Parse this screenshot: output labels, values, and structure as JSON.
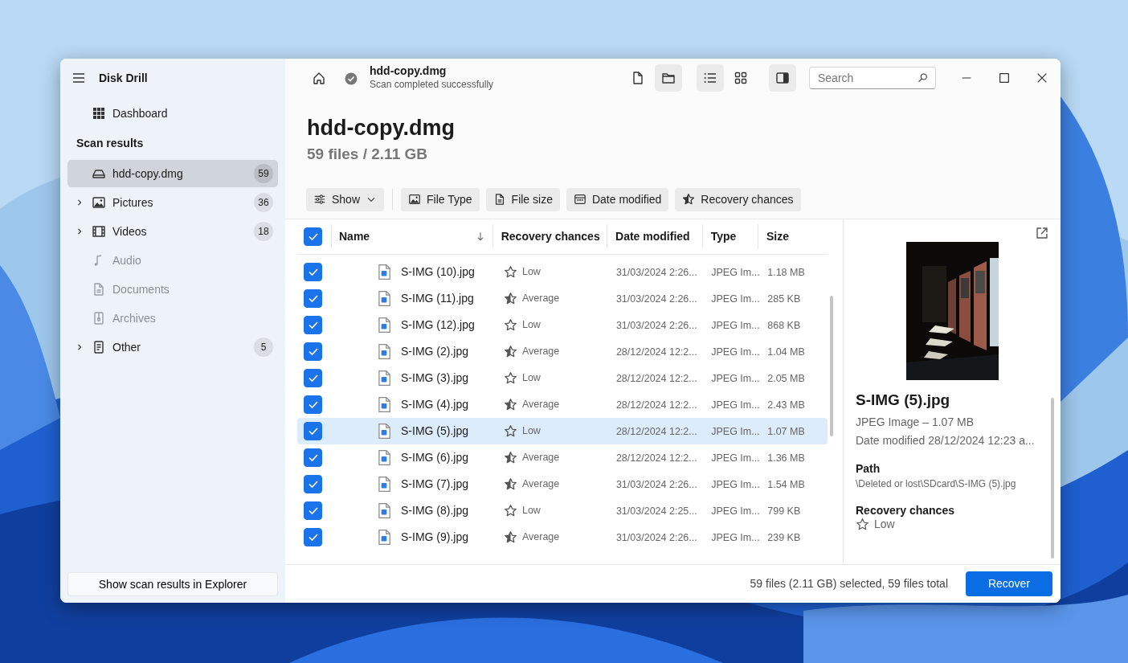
{
  "app": {
    "title": "Disk Drill"
  },
  "sidebar": {
    "dashboard": "Dashboard",
    "section": "Scan results",
    "items": [
      {
        "label": "hdd-copy.dmg",
        "count": "59",
        "expandable": false,
        "selected": true,
        "disabled": false
      },
      {
        "label": "Pictures",
        "count": "36",
        "expandable": true,
        "selected": false,
        "disabled": false
      },
      {
        "label": "Videos",
        "count": "18",
        "expandable": true,
        "selected": false,
        "disabled": false
      },
      {
        "label": "Audio",
        "expandable": false,
        "selected": false,
        "disabled": true
      },
      {
        "label": "Documents",
        "expandable": false,
        "selected": false,
        "disabled": true
      },
      {
        "label": "Archives",
        "expandable": false,
        "selected": false,
        "disabled": true
      },
      {
        "label": "Other",
        "count": "5",
        "expandable": true,
        "selected": false,
        "disabled": false
      }
    ],
    "explorer_button": "Show scan results in Explorer"
  },
  "header": {
    "source": "hdd-copy.dmg",
    "status": "Scan completed successfully",
    "toolbar": [
      {
        "kind": "file",
        "selected": false
      },
      {
        "kind": "folder",
        "selected": true
      },
      {
        "kind": "list",
        "selected": true
      },
      {
        "kind": "grid",
        "selected": false
      },
      {
        "kind": "panel",
        "selected": true
      }
    ],
    "search": {
      "placeholder": "Search"
    }
  },
  "heading": {
    "title": "hdd-copy.dmg",
    "summary": "59 files / 2.11 GB"
  },
  "filters": [
    {
      "label": "Show",
      "dropdown": true
    },
    {
      "label": "File Type",
      "dropdown": false
    },
    {
      "label": "File size",
      "dropdown": false
    },
    {
      "label": "Date modified",
      "dropdown": false
    },
    {
      "label": "Recovery chances",
      "dropdown": false
    }
  ],
  "table": {
    "all_checked": true,
    "columns": [
      {
        "label": "Name",
        "sorted": true
      },
      {
        "label": "Recovery chances",
        "sorted": false
      },
      {
        "label": "Date modified",
        "sorted": false
      },
      {
        "label": "Type",
        "sorted": false
      },
      {
        "label": "Size",
        "sorted": false
      }
    ],
    "rows": [
      {
        "name": "S-IMG (10).jpg",
        "chances": "Low",
        "kind": "low",
        "date": "31/03/2024 2:26...",
        "type": "JPEG Im...",
        "size": "1.18 MB",
        "checked": true,
        "selected": false
      },
      {
        "name": "S-IMG (11).jpg",
        "chances": "Average",
        "kind": "average",
        "date": "31/03/2024 2:26...",
        "type": "JPEG Im...",
        "size": "285 KB",
        "checked": true,
        "selected": false
      },
      {
        "name": "S-IMG (12).jpg",
        "chances": "Low",
        "kind": "low",
        "date": "31/03/2024 2:26...",
        "type": "JPEG Im...",
        "size": "868 KB",
        "checked": true,
        "selected": false
      },
      {
        "name": "S-IMG (2).jpg",
        "chances": "Average",
        "kind": "average",
        "date": "28/12/2024 12:2...",
        "type": "JPEG Im...",
        "size": "1.04 MB",
        "checked": true,
        "selected": false
      },
      {
        "name": "S-IMG (3).jpg",
        "chances": "Low",
        "kind": "low",
        "date": "28/12/2024 12:2...",
        "type": "JPEG Im...",
        "size": "2.05 MB",
        "checked": true,
        "selected": false
      },
      {
        "name": "S-IMG (4).jpg",
        "chances": "Average",
        "kind": "average",
        "date": "28/12/2024 12:2...",
        "type": "JPEG Im...",
        "size": "2.43 MB",
        "checked": true,
        "selected": false
      },
      {
        "name": "S-IMG (5).jpg",
        "chances": "Low",
        "kind": "low",
        "date": "28/12/2024 12:2...",
        "type": "JPEG Im...",
        "size": "1.07 MB",
        "checked": true,
        "selected": true
      },
      {
        "name": "S-IMG (6).jpg",
        "chances": "Average",
        "kind": "average",
        "date": "28/12/2024 12:2...",
        "type": "JPEG Im...",
        "size": "1.36 MB",
        "checked": true,
        "selected": false
      },
      {
        "name": "S-IMG (7).jpg",
        "chances": "Average",
        "kind": "average",
        "date": "31/03/2024 2:26...",
        "type": "JPEG Im...",
        "size": "1.54 MB",
        "checked": true,
        "selected": false
      },
      {
        "name": "S-IMG (8).jpg",
        "chances": "Low",
        "kind": "low",
        "date": "31/03/2024 2:25...",
        "type": "JPEG Im...",
        "size": "799 KB",
        "checked": true,
        "selected": false
      },
      {
        "name": "S-IMG (9).jpg",
        "chances": "Average",
        "kind": "average",
        "date": "31/03/2024 2:26...",
        "type": "JPEG Im...",
        "size": "239 KB",
        "checked": true,
        "selected": false
      }
    ]
  },
  "preview": {
    "name": "S-IMG (5).jpg",
    "info": "JPEG Image – 1.07 MB",
    "date": "Date modified 28/12/2024 12:23 a...",
    "path_label": "Path",
    "path": "\\Deleted or lost\\SDcard\\S-IMG (5).jpg",
    "chances_label": "Recovery chances",
    "chances": "Low",
    "kind": "low"
  },
  "footer": {
    "status": "59 files (2.11 GB) selected, 59 files total",
    "recover_button": "Recover"
  }
}
